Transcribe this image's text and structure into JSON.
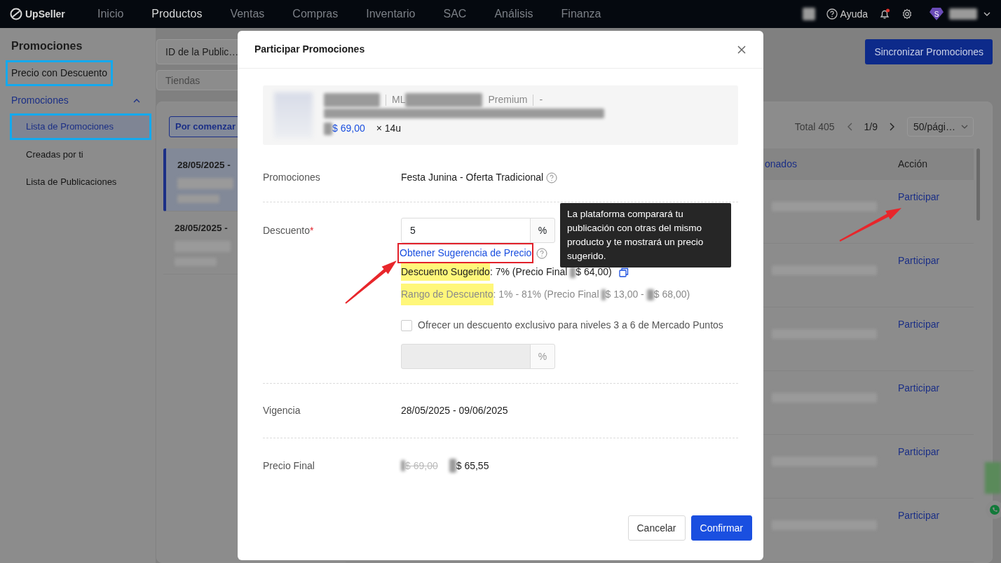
{
  "nav": {
    "logo": "UpSeller",
    "items": [
      {
        "label": "Inicio",
        "selected": false
      },
      {
        "label": "Productos",
        "selected": true
      },
      {
        "label": "Ventas",
        "selected": false
      },
      {
        "label": "Compras",
        "selected": false
      },
      {
        "label": "Inventario",
        "selected": false
      },
      {
        "label": "SAC",
        "selected": false
      },
      {
        "label": "Análisis",
        "selected": false
      },
      {
        "label": "Finanza",
        "selected": false
      }
    ],
    "help": "Ayuda",
    "avatar_letter": "S",
    "notification": true
  },
  "sidebar": {
    "title": "Promociones",
    "items": [
      {
        "label": "Precio con Descuento",
        "highlighted": true,
        "selected": false
      }
    ],
    "group": {
      "label": "Promociones",
      "expanded": true,
      "children": [
        {
          "label": "Lista de Promociones",
          "selected": true,
          "highlighted": true
        },
        {
          "label": "Creadas por ti",
          "selected": false,
          "highlighted": false
        },
        {
          "label": "Lista de Publicaciones",
          "selected": false,
          "highlighted": false
        }
      ]
    }
  },
  "filters": {
    "listing_select": "ID de la Public…",
    "store_placeholder": "Tiendas"
  },
  "sync_button": "Sincronizar Promociones",
  "status_tab": "Por comenzar",
  "promo_list": [
    {
      "dates": "28/05/2025 -",
      "selected": true
    },
    {
      "dates": "28/05/2025 -",
      "selected": false
    }
  ],
  "pagination": {
    "total": "Total 405",
    "page": "1/9",
    "page_size": "50/pági…"
  },
  "table": {
    "columns": [
      "onados",
      "Acción"
    ],
    "rows": [
      {
        "action": "Participar"
      },
      {
        "action": "Participar"
      },
      {
        "action": "Participar"
      },
      {
        "action": "Participar"
      },
      {
        "action": "Participar"
      },
      {
        "action": "Participar"
      }
    ]
  },
  "modal": {
    "title": "Participar Promociones",
    "product": {
      "code_prefix": "ML",
      "listing_type": "Premium",
      "separator": "-",
      "price": "$ 69,00",
      "quantity": "× 14u"
    },
    "promotion": {
      "label": "Promociones",
      "value": "Festa Junina - Oferta Tradicional"
    },
    "discount": {
      "label": "Descuento",
      "required_mark": "*",
      "value": "5",
      "unit": "%",
      "suggest_link": "Obtener Sugerencia de Precio",
      "suggest_highlighted": true,
      "suggested": {
        "label": "Descuento Sugerido",
        "highlighted": true,
        "text": ": 7% (Precio Final",
        "price": "$ 64,00)"
      },
      "range": {
        "label": "Rango de Descuento",
        "highlighted": true,
        "text": ": 1% - 81% (Precio Final",
        "min": "$ 13,00 -",
        "max": "$ 68,00)"
      },
      "exclusive": {
        "label": "Ofrecer un descuento exclusivo para niveles 3 a 6 de Mercado Puntos",
        "checked": false,
        "unit": "%",
        "disabled": true
      }
    },
    "validity": {
      "label": "Vigencia",
      "value": "28/05/2025 - 09/06/2025"
    },
    "final_price": {
      "label": "Precio Final",
      "old": "$ 69,00",
      "new": "$ 65,55"
    },
    "tooltip": "La plataforma comparará tu publicación con otras del mismo producto y te mostrará un precio sugerido.",
    "buttons": [
      {
        "label": "Cancelar",
        "kind": "secondary"
      },
      {
        "label": "Confirmar",
        "kind": "primary"
      }
    ]
  }
}
